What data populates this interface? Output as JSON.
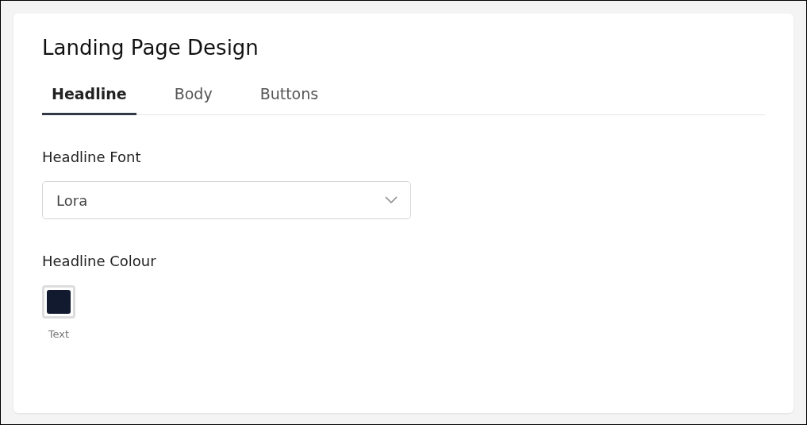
{
  "title": "Landing Page Design",
  "tabs": [
    {
      "label": "Headline",
      "selected": true
    },
    {
      "label": "Body",
      "selected": false
    },
    {
      "label": "Buttons",
      "selected": false
    }
  ],
  "font_field": {
    "label": "Headline Font",
    "value": "Lora"
  },
  "colour_field": {
    "label": "Headline Colour",
    "swatches": [
      {
        "label": "Text",
        "color": "#111a2e"
      }
    ]
  }
}
